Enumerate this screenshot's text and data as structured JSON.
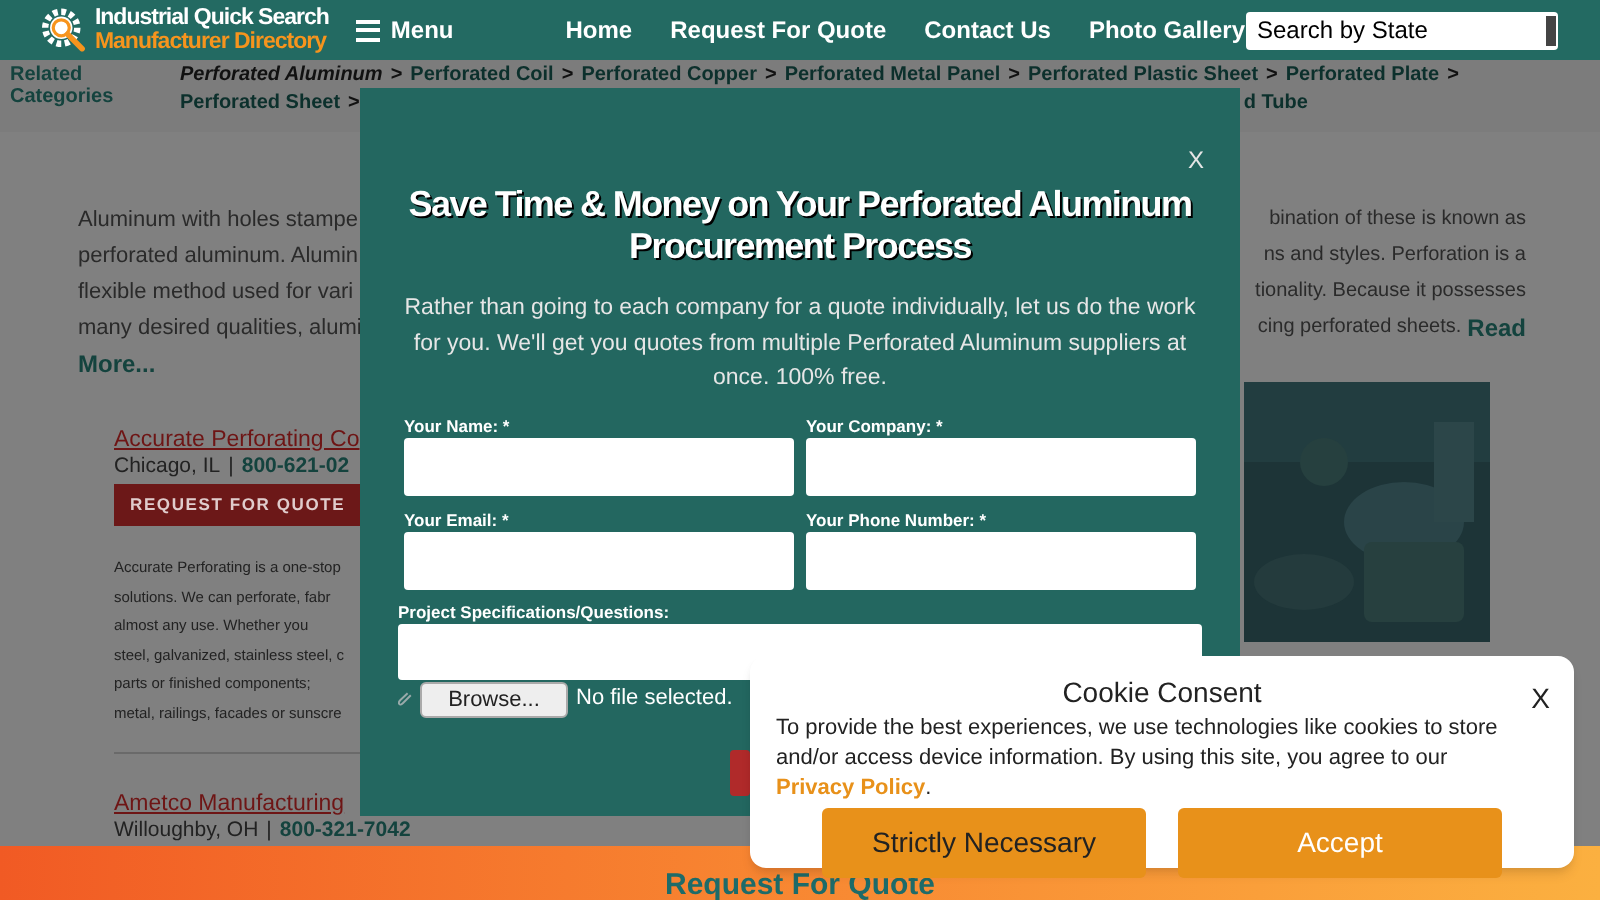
{
  "header": {
    "logo": {
      "line1": "Industrial Quick Search",
      "line2": "Manufacturer Directory"
    },
    "menu_label": "Menu",
    "nav": [
      "Home",
      "Request For Quote",
      "Contact Us",
      "Photo Gallery"
    ],
    "state_select": "Search by State"
  },
  "related": {
    "label_lines": [
      "Related",
      "Categories"
    ],
    "separator": ">",
    "rows": [
      [
        {
          "label": "Perforated Aluminum",
          "selected": true
        },
        {
          "label": "Perforated Coil",
          "selected": false
        },
        {
          "label": "Perforated Copper",
          "selected": false
        },
        {
          "label": "Perforated Metal Panel",
          "selected": false
        },
        {
          "label": "Perforated Plastic Sheet",
          "selected": false
        },
        {
          "label": "Perforated Plate",
          "selected": false
        }
      ],
      [
        {
          "label": "Perforated Sheet",
          "selected": false
        }
      ]
    ],
    "cut_item": "d Tube"
  },
  "intro": {
    "left_lines": [
      "Aluminum with holes stampe",
      "perforated aluminum. Alumin",
      "flexible method used for vari",
      "many desired qualities, alumi"
    ],
    "left_link": "More...",
    "right_lines": [
      "bination of these is known as",
      "ns and styles. Perforation is a",
      "tionality. Because it possesses",
      "cing perforated sheets."
    ],
    "right_link": "Read"
  },
  "companies": [
    {
      "name": "Accurate Perforating Co",
      "location": "Chicago, IL",
      "separator": "|",
      "phone": "800-621-02",
      "button": "REQUEST FOR QUOTE",
      "description_lines": [
        "Accurate Perforating is a one-stop",
        "solutions. We can perforate, fabr",
        "almost any use. Whether you",
        "steel, galvanized, stainless steel, c",
        "parts or finished components;",
        "metal, railings, facades or sunscre"
      ]
    },
    {
      "name": "Ametco Manufacturing",
      "location": "Willoughby, OH",
      "separator": "|",
      "phone": "800-321-7042"
    }
  ],
  "quote_modal": {
    "close": "X",
    "title_lines": [
      "Save Time & Money on Your Perforated Aluminum",
      "Procurement Process"
    ],
    "description": "Rather than going to each company for a quote individually, let us do the work for you. We'll get you quotes from multiple Perforated Aluminum suppliers at once. 100% free.",
    "fields": [
      {
        "label": "Your Name: *"
      },
      {
        "label": "Your Company: *"
      },
      {
        "label": "Your Email: *"
      },
      {
        "label": "Your Phone Number: *"
      }
    ],
    "project_label": "Project Specifications/Questions:",
    "browse_button": "Browse...",
    "file_status": "No file selected."
  },
  "cookie_consent": {
    "title": "Cookie Consent",
    "close": "X",
    "text": "To provide the best experiences, we use technologies like cookies to store and/or access device information. By using this site, you agree to our",
    "link": "Privacy Policy",
    "after_link": ".",
    "buttons": [
      {
        "label": "Strictly Necessary",
        "kind": "secondary"
      },
      {
        "label": "Accept",
        "kind": "primary"
      }
    ]
  },
  "bottom_bar": {
    "label": "Request For Quote"
  }
}
